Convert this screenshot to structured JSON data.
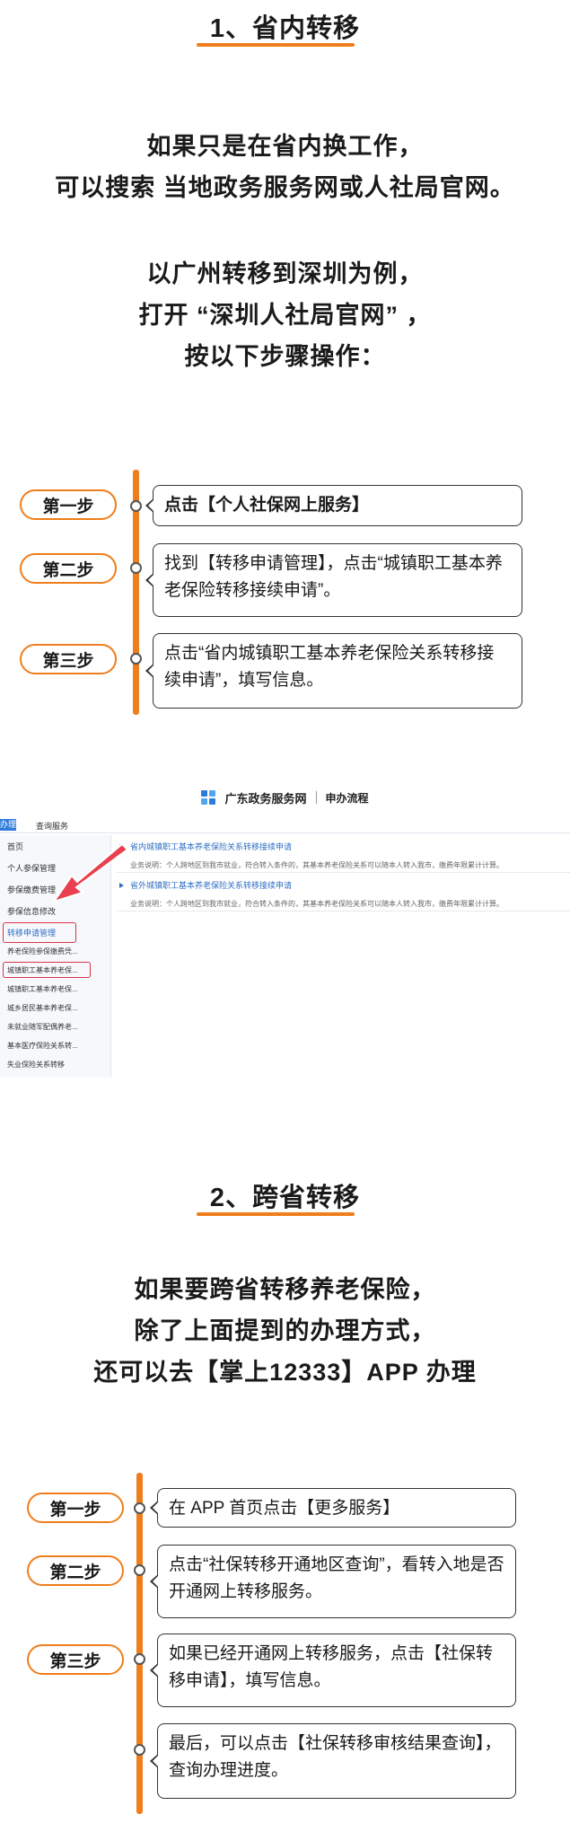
{
  "section1": {
    "title": "1、省内转移",
    "paragraph1": [
      "如果只是在省内换工作，",
      "可以搜索 当地政务服务网或人社局官网。"
    ],
    "paragraph2": [
      "以广州转移到深圳为例，",
      "打开 “深圳人社局官网” ，",
      "按以下步骤操作："
    ],
    "steps": [
      {
        "label": "第一步",
        "text": "点击【个人社保网上服务】"
      },
      {
        "label": "第二步",
        "text": "找到【转移申请管理】，点击“城镇职工基本养老保险转移接续申请”。"
      },
      {
        "label": "第三步",
        "text": "点击“省内城镇职工基本养老保险关系转移接续申请”，填写信息。"
      }
    ]
  },
  "screenshot": {
    "brand": "广东政务服务网",
    "flow": "申办流程",
    "tab_active": "办理",
    "tab_query": "查询服务",
    "sidebar": [
      "首页",
      "个人参保管理",
      "参保缴费管理",
      "参保信息修改",
      "转移申请管理",
      "养老保险参保缴费凭...",
      "城镇职工基本养老保...",
      "城镇职工基本养老保...",
      "城乡居民基本养老保...",
      "未就业随军配偶养老...",
      "基本医疗保险关系转...",
      "失业保险关系转移"
    ],
    "items": [
      {
        "link": "省内城镇职工基本养老保险关系转移接续申请",
        "desc": "业务说明：个人跨地区到我市就业，符合转入条件的，其基本养老保险关系可以随本人转入我市，缴费年限累计计算。"
      },
      {
        "link": "省外城镇职工基本养老保险关系转移接续申请",
        "desc": "业务说明：个人跨地区到我市就业，符合转入条件的，其基本养老保险关系可以随本人转入我市，缴费年限累计计算。"
      }
    ]
  },
  "section2": {
    "title": "2、跨省转移",
    "paragraph": [
      "如果要跨省转移养老保险，",
      "除了上面提到的办理方式，",
      "还可以去【掌上12333】APP 办理"
    ],
    "steps": [
      {
        "label": "第一步",
        "text": "在 APP 首页点击【更多服务】"
      },
      {
        "label": "第二步",
        "text": "点击“社保转移开通地区查询”，看转入地是否开通网上转移服务。"
      },
      {
        "label": "第三步",
        "text": "如果已经开通网上转移服务，点击【社保转移申请】，填写信息。"
      },
      {
        "label": "",
        "text": "最后，可以点击【社保转移审核结果查询】，查询办理进度。"
      }
    ]
  },
  "colors": {
    "accent": "#f07d1b",
    "link": "#2f6fc4",
    "highlight": "#d9344a"
  }
}
